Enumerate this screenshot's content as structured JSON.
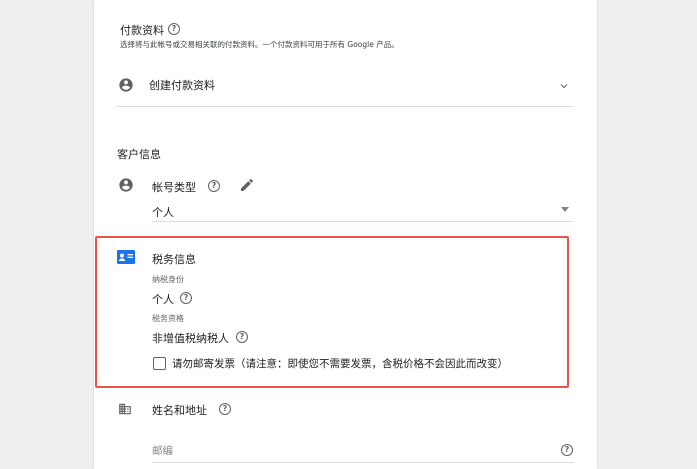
{
  "payment_profile": {
    "title": "付款资料",
    "description": "选择将与此帐号或交易相关联的付款资料。一个付款资料可用于所有 Google 产品。",
    "select_value": "创建付款资料"
  },
  "customer_info": {
    "heading": "客户信息",
    "account_type": {
      "label": "帐号类型",
      "value": "个人"
    }
  },
  "tax_info": {
    "heading": "税务信息",
    "tax_identity_label": "纳税身份",
    "tax_identity_value": "个人",
    "tax_status_label": "税务资格",
    "tax_status_value": "非增值税纳税人",
    "invoice_checkbox_label": "请勿邮寄发票（请注意：即使您不需要发票，含税价格不会因此而改变）",
    "invoice_checkbox_checked": false
  },
  "name_address": {
    "heading": "姓名和地址",
    "postal_code_placeholder": "邮编"
  },
  "colors": {
    "highlight_border": "#e8534f",
    "icon_gray": "#5f6368",
    "tax_icon_blue": "#1a73e8"
  }
}
